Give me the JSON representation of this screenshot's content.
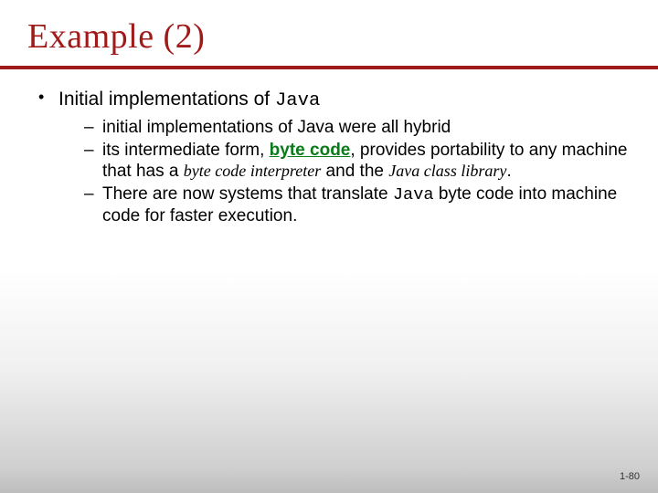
{
  "title": "Example (2)",
  "bullet1": {
    "prefix": "Initial implementations of ",
    "java": "Java"
  },
  "sub1": "initial implementations of Java were all hybrid",
  "sub2": {
    "a": "its intermediate form, ",
    "bc": "byte code",
    "b": ", provides portability to any machine that has a ",
    "it1": "byte code interpreter",
    "c": " and the ",
    "it2": "Java class library",
    "d": "."
  },
  "sub3": {
    "a": "There are now systems that translate ",
    "java": "Java",
    "b": " byte code into machine code for faster execution."
  },
  "pagenum": "1-80"
}
